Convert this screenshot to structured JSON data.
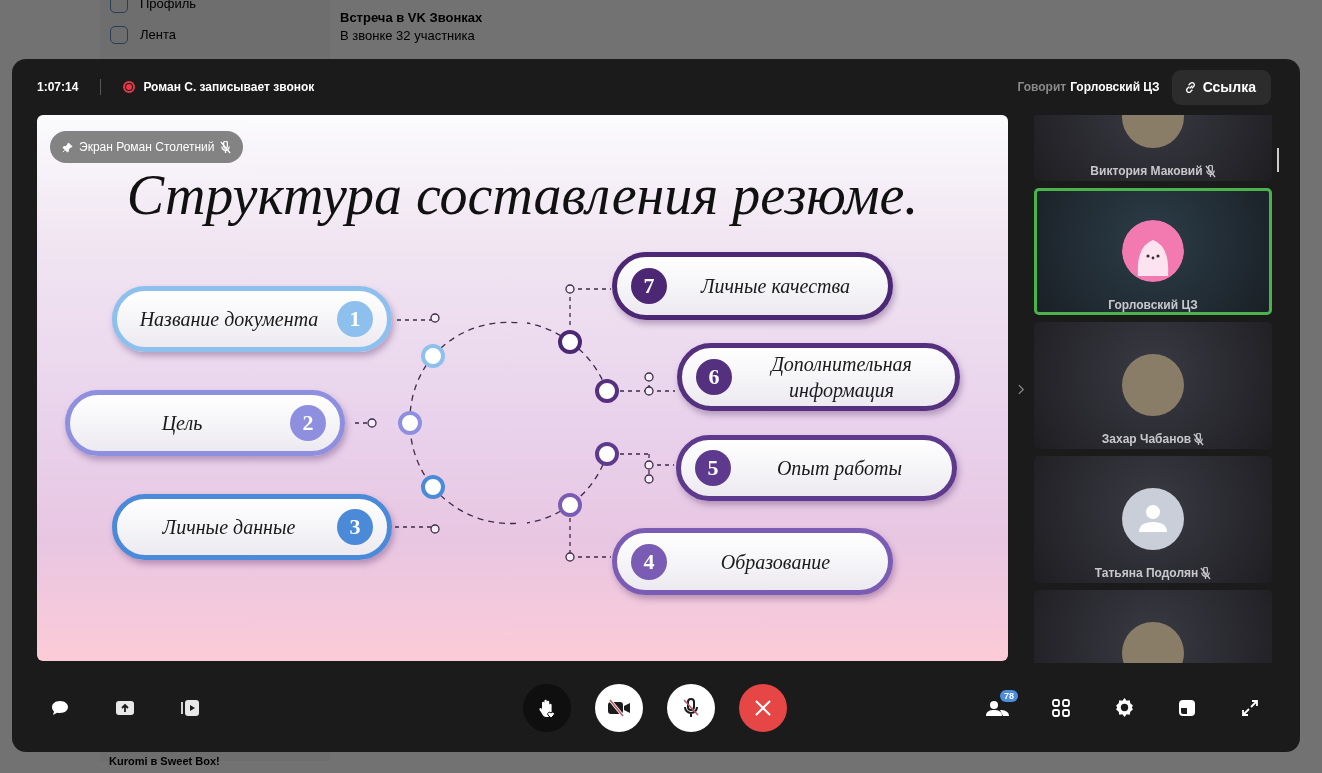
{
  "background_page": {
    "sidebar_items": [
      {
        "label": "Профиль"
      },
      {
        "label": "Лента"
      }
    ],
    "chat": {
      "title": "Встреча в VK Звонках",
      "subtitle": "В звонке 32 участника"
    },
    "footer_message": "Kuromi в Sweet Box!"
  },
  "call": {
    "timer": "1:07:14",
    "recording": "Роман С. записывает звонок",
    "speaking_label": "Говорит",
    "speaker": "Горловский ЦЗ",
    "link_button": "Ссылка"
  },
  "screen_share": {
    "label": "Экран Роман Столетний",
    "muted": true,
    "slide": {
      "title": "Структура составления резюме.",
      "items": [
        {
          "number": "7",
          "label": "Личные качества",
          "kind": "right",
          "color": "#4c2874"
        },
        {
          "number": "1",
          "label": "Название документа",
          "kind": "left",
          "color": "#8ec0ee"
        },
        {
          "number": "6",
          "label": "Дополнительная информация",
          "kind": "right",
          "color": "#55307f"
        },
        {
          "number": "2",
          "label": "Цель",
          "kind": "left",
          "color": "#8f8fe0"
        },
        {
          "number": "5",
          "label": "Опыт работы",
          "kind": "right",
          "color": "#5e3a8e"
        },
        {
          "number": "3",
          "label": "Личные данные",
          "kind": "left",
          "color": "#4a8ad8"
        },
        {
          "number": "4",
          "label": "Образование",
          "kind": "right",
          "color": "#7a5cb4"
        }
      ]
    }
  },
  "participants": [
    {
      "name": "Виктория Маковий",
      "muted": true,
      "selected": false,
      "kind": "photo"
    },
    {
      "name": "Горловский ЦЗ",
      "muted": false,
      "selected": true,
      "kind": "illustration"
    },
    {
      "name": "Захар Чабанов",
      "muted": true,
      "selected": false,
      "kind": "photo"
    },
    {
      "name": "Татьяна Подолян",
      "muted": true,
      "selected": false,
      "kind": "default"
    },
    {
      "kind": "photo",
      "muted": false,
      "selected": false
    }
  ],
  "controls": {
    "participants_count": "78"
  }
}
